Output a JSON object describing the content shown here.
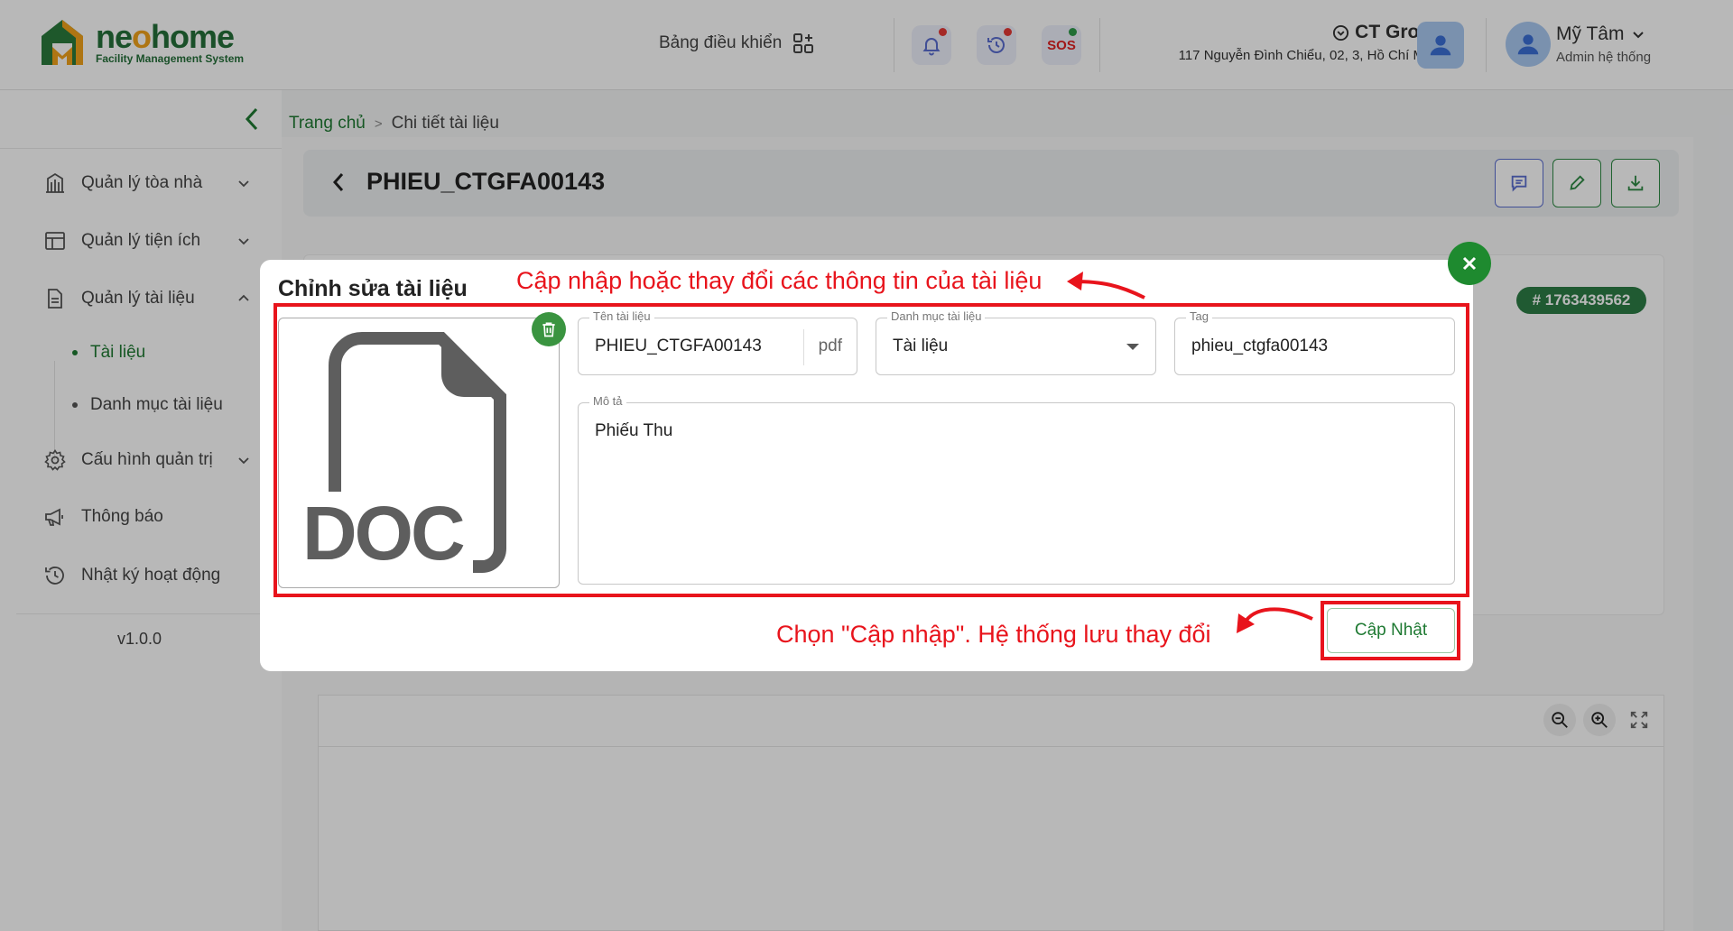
{
  "header": {
    "logo_name_a": "ne",
    "logo_name_o": "o",
    "logo_name_b": "home",
    "logo_subtitle": "Facility Management System",
    "dashboard_label": "Bảng điều khiển",
    "sos_label": "SOS",
    "org_name": "CT Group",
    "org_address": "117 Nguyễn Đình Chiểu, 02, 3, Hồ Chí Minh",
    "user_name": "Mỹ Tâm",
    "user_role": "Admin hệ thống"
  },
  "sidebar": {
    "items": [
      {
        "label": "Quản lý tòa nhà",
        "icon": "building-icon"
      },
      {
        "label": "Quản lý tiện ích",
        "icon": "layout-icon"
      },
      {
        "label": "Quản lý tài liệu",
        "icon": "document-icon"
      },
      {
        "label": "Cấu hình quản trị",
        "icon": "gear-icon"
      },
      {
        "label": "Thông báo",
        "icon": "megaphone-icon"
      },
      {
        "label": "Nhật ký hoạt động",
        "icon": "history-icon"
      }
    ],
    "sub_items": [
      {
        "label": "Tài liệu",
        "active": true
      },
      {
        "label": "Danh mục tài liệu",
        "active": false
      }
    ],
    "version": "v1.0.0"
  },
  "breadcrumb": {
    "home": "Trang chủ",
    "separator": ">",
    "current": "Chi tiết tài liệu"
  },
  "page": {
    "title": "PHIEU_CTGFA00143",
    "id_badge": "# 1763439562"
  },
  "modal": {
    "title": "Chỉnh sửa tài liệu",
    "file_type_text": "DOC",
    "fields": {
      "name_label": "Tên tài liệu",
      "name_value": "PHIEU_CTGFA00143",
      "name_suffix": "pdf",
      "category_label": "Danh mục tài liệu",
      "category_value": "Tài liệu",
      "tag_label": "Tag",
      "tag_value": "phieu_ctgfa00143",
      "desc_label": "Mô tả",
      "desc_value": "Phiếu Thu"
    },
    "update_label": "Cập Nhật"
  },
  "annotations": {
    "top_text": "Cập nhập hoặc thay đổi các thông tin của tài liệu",
    "bottom_text": "Chọn \"Cập nhập\". Hệ thống lưu thay đổi",
    "color": "#e8141c"
  },
  "colors": {
    "brand_green": "#1f7a33",
    "brand_orange": "#f2a31b",
    "badge_green": "#2d7d46",
    "accent_blue": "#5b6ed0"
  }
}
